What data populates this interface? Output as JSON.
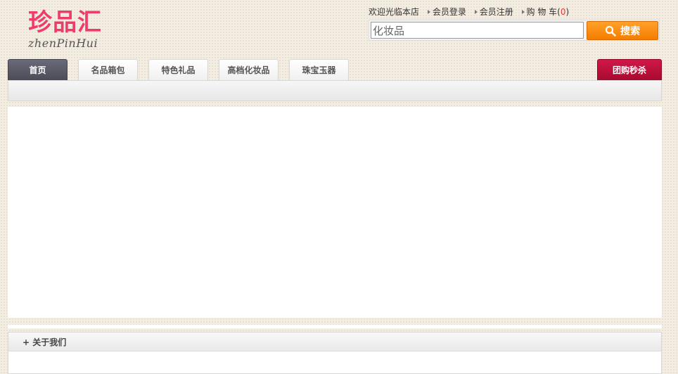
{
  "logo": {
    "title_cn": "珍品汇",
    "title_en": "zhenPinHui"
  },
  "top_links": {
    "welcome": "欢迎光临本店",
    "login": "会员登录",
    "register": "会员注册",
    "cart_label": "购 物 车(",
    "cart_count": "0",
    "cart_close": ")"
  },
  "search": {
    "value": "化妆品",
    "button_label": "搜索"
  },
  "nav": {
    "tabs": [
      {
        "label": "首页",
        "active": true
      },
      {
        "label": "名品箱包"
      },
      {
        "label": "特色礼品"
      },
      {
        "label": "高档化妆品"
      },
      {
        "label": "珠宝玉器"
      }
    ],
    "promo": {
      "label": "团购秒杀"
    }
  },
  "about": {
    "title": "+ 关于我们"
  },
  "colors": {
    "brand": "#ee3b6b",
    "search_button": "#f57d00",
    "promo_tab": "#b8103a",
    "active_tab": "#55555f"
  }
}
